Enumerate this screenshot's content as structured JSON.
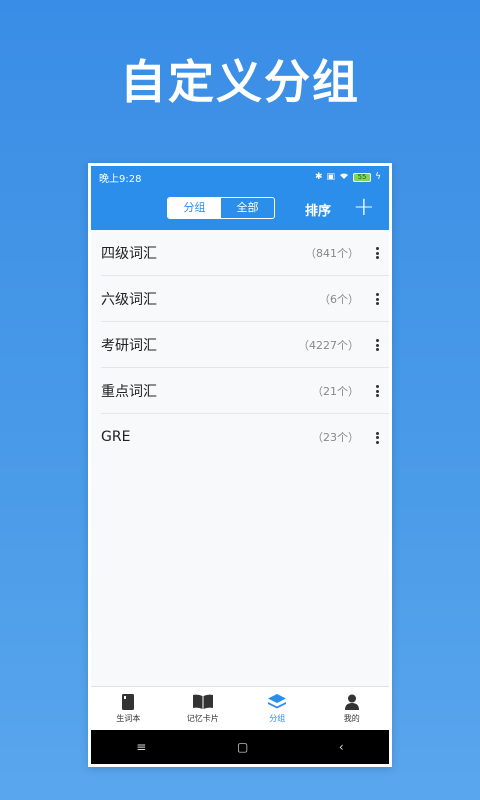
{
  "promo": {
    "title": "自定义分组"
  },
  "status": {
    "time": "晚上9:28",
    "battery": "55"
  },
  "appbar": {
    "segments": [
      "分组",
      "全部"
    ],
    "sort_label": "排序",
    "add_label": "+"
  },
  "groups": [
    {
      "name": "四级词汇",
      "count": "（841个）"
    },
    {
      "name": "六级词汇",
      "count": "（6个）"
    },
    {
      "name": "考研词汇",
      "count": "（4227个）"
    },
    {
      "name": "重点词汇",
      "count": "（21个）"
    },
    {
      "name": "GRE",
      "count": "（23个）"
    }
  ],
  "tabs": [
    {
      "label": "生词本",
      "icon": "notebook-icon"
    },
    {
      "label": "记忆卡片",
      "icon": "open-book-icon"
    },
    {
      "label": "分组",
      "icon": "layers-icon"
    },
    {
      "label": "我的",
      "icon": "person-icon"
    }
  ],
  "nav": {
    "menu": "≡",
    "home": "▢",
    "back": "‹"
  },
  "colors": {
    "accent": "#2b8eea",
    "background": "#3a8de6"
  }
}
